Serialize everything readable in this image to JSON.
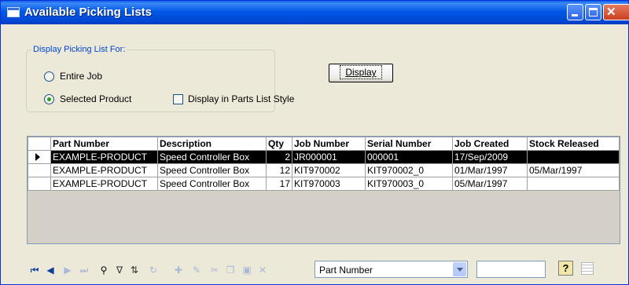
{
  "window": {
    "title": "Available Picking Lists"
  },
  "group": {
    "legend": "Display Picking List For:",
    "options": [
      {
        "label": "Entire Job",
        "checked": false
      },
      {
        "label": "Selected Product",
        "checked": true
      }
    ],
    "parts_list_style_label": "Display in Parts List Style",
    "parts_list_style_checked": false
  },
  "display_button": "Display",
  "table": {
    "headers": [
      "Part Number",
      "Description",
      "Qty",
      "Job Number",
      "Serial Number",
      "Job Created",
      "Stock Released"
    ],
    "rows": [
      {
        "part": "EXAMPLE-PRODUCT",
        "desc": "Speed Controller Box",
        "qty": "2",
        "job": "JR000001",
        "serial": "000001",
        "created": "17/Sep/2009",
        "released": "",
        "selected": true
      },
      {
        "part": "EXAMPLE-PRODUCT",
        "desc": "Speed Controller Box",
        "qty": "12",
        "job": "KIT970002",
        "serial": "KIT970002_0",
        "created": "01/Mar/1997",
        "released": "05/Mar/1997",
        "selected": false
      },
      {
        "part": "EXAMPLE-PRODUCT",
        "desc": "Speed Controller Box",
        "qty": "17",
        "job": "KIT970003",
        "serial": "KIT970003_0",
        "created": "05/Mar/1997",
        "released": "",
        "selected": false
      }
    ]
  },
  "navigator": {
    "search_field_selected": "Part Number",
    "search_value": "",
    "icons": [
      "first-record-icon",
      "prior-record-icon",
      "next-record-icon",
      "last-record-icon",
      "find-icon",
      "filter-icon",
      "sort-icon",
      "refresh-icon",
      "insert-icon",
      "edit-icon",
      "delete-icon",
      "copy-icon",
      "save-icon",
      "cancel-icon"
    ]
  },
  "colors": {
    "title_bar": "#0058e6",
    "selected_row": "#000000",
    "window_bg": "#ece9d8"
  }
}
